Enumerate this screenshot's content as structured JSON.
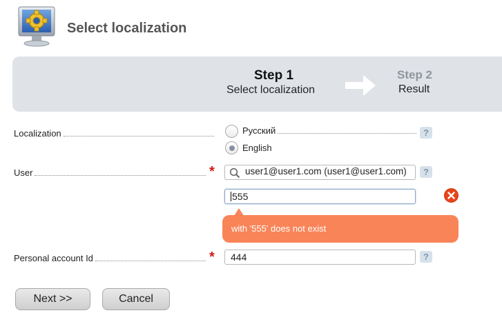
{
  "header": {
    "title": "Select localization",
    "icon": "settings-monitor-icon"
  },
  "steps": [
    {
      "title": "Step 1",
      "subtitle": "Select localization",
      "state": "current"
    },
    {
      "title": "Step 2",
      "subtitle": "Result",
      "state": "upcoming"
    }
  ],
  "form": {
    "localization": {
      "label": "Localization",
      "options": [
        {
          "label": "Русский",
          "checked": false
        },
        {
          "label": "English",
          "checked": true
        }
      ],
      "help": "?"
    },
    "user": {
      "label": "User",
      "required_mark": "*",
      "value": "user1@user1.com (user1@user1.com)",
      "search_value": "555",
      "help": "?",
      "error": "with '555' does not exist"
    },
    "personal_account": {
      "label": "Personal account Id",
      "required_mark": "*",
      "value": "444",
      "help": "?"
    }
  },
  "buttons": {
    "next": "Next >>",
    "cancel": "Cancel"
  },
  "colors": {
    "steps_bar": "#dfe3e8",
    "error": "#e8441a",
    "error_bubble": "#f98458",
    "required": "#d01818"
  }
}
